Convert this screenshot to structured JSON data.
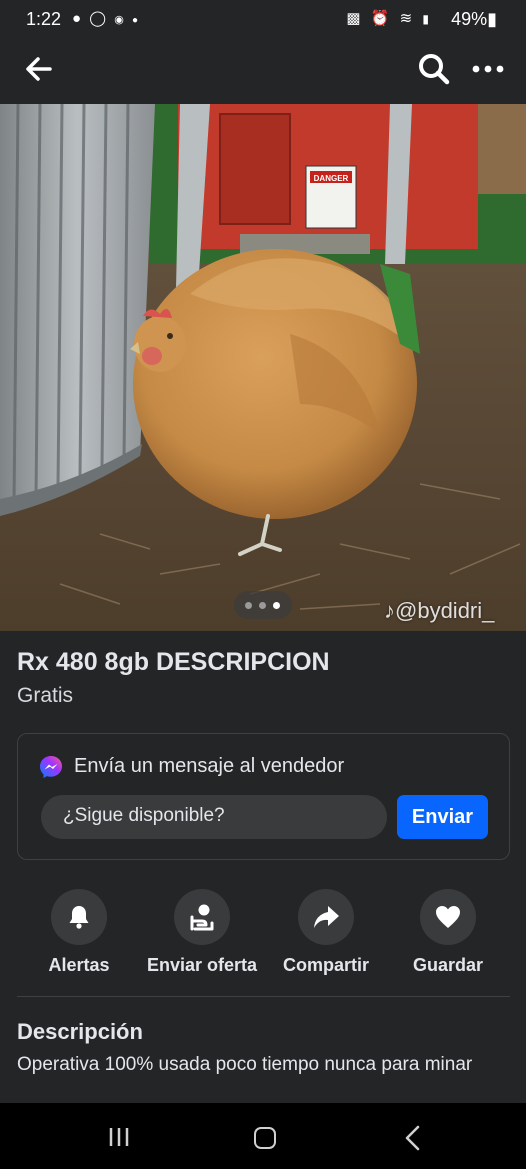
{
  "status_bar": {
    "time": "1:22",
    "battery": "49%",
    "left_icons": [
      "snapchat-icon",
      "whatsapp-icon",
      "g-icon",
      "dot-icon"
    ],
    "right_icons": [
      "battery-saver-icon",
      "alarm-icon",
      "wifi-icon",
      "signal-icon"
    ]
  },
  "app_bar": {
    "icons": [
      "back-arrow-icon",
      "search-icon",
      "more-dots-icon"
    ]
  },
  "photo": {
    "watermark": "@bydidri_",
    "sign_text": "DANGER",
    "pager_count": 3,
    "pager_active_index": 2
  },
  "listing": {
    "title": "Rx 480 8gb DESCRIPCION",
    "price": "Gratis"
  },
  "message_card": {
    "title": "Envía un mensaje al vendedor",
    "input_value": "¿Sigue disponible?",
    "send_label": "Enviar"
  },
  "actions": [
    {
      "label": "Alertas",
      "icon": "bell-icon"
    },
    {
      "label": "Enviar oferta",
      "icon": "offer-icon"
    },
    {
      "label": "Compartir",
      "icon": "share-icon"
    },
    {
      "label": "Guardar",
      "icon": "heart-icon"
    }
  ],
  "description": {
    "heading": "Descripción",
    "text": "Operativa 100% usada poco tiempo nunca para minar"
  },
  "colors": {
    "background": "#242526",
    "send_button": "#0866ff",
    "chip": "#3a3b3c"
  }
}
